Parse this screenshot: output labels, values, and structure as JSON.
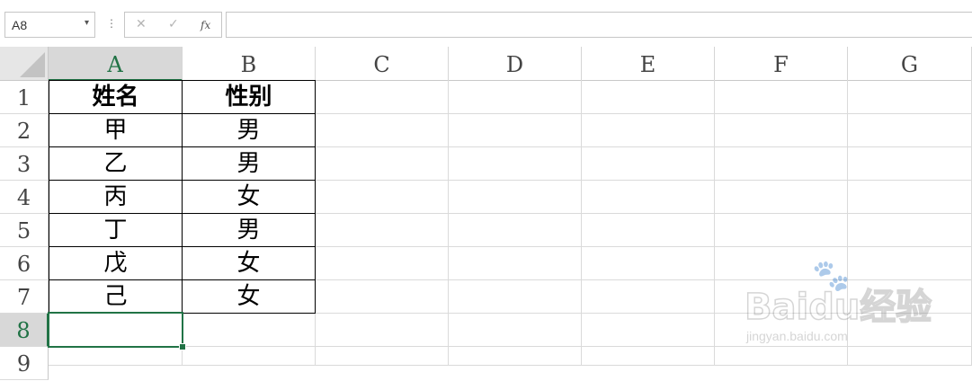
{
  "formula_bar": {
    "name_box_value": "A8",
    "name_box_arrow": "▾",
    "separator": "⋮",
    "cancel_icon": "✕",
    "enter_icon": "✓",
    "fx_label": "fx",
    "formula_value": ""
  },
  "columns": [
    "A",
    "B",
    "C",
    "D",
    "E",
    "F",
    "G"
  ],
  "rows": [
    "1",
    "2",
    "3",
    "4",
    "5",
    "6",
    "7",
    "8",
    "9"
  ],
  "active_cell": "A8",
  "table": {
    "headers": [
      "姓名",
      "性别"
    ],
    "data": [
      [
        "甲",
        "男"
      ],
      [
        "乙",
        "男"
      ],
      [
        "丙",
        "女"
      ],
      [
        "丁",
        "男"
      ],
      [
        "戊",
        "女"
      ],
      [
        "己",
        "女"
      ]
    ]
  },
  "watermark": {
    "brand": "Baidu经验",
    "url": "jingyan.baidu.com"
  },
  "colors": {
    "accent": "#217346",
    "grid": "#dadada",
    "header_active_bg": "#d8d8d8"
  }
}
